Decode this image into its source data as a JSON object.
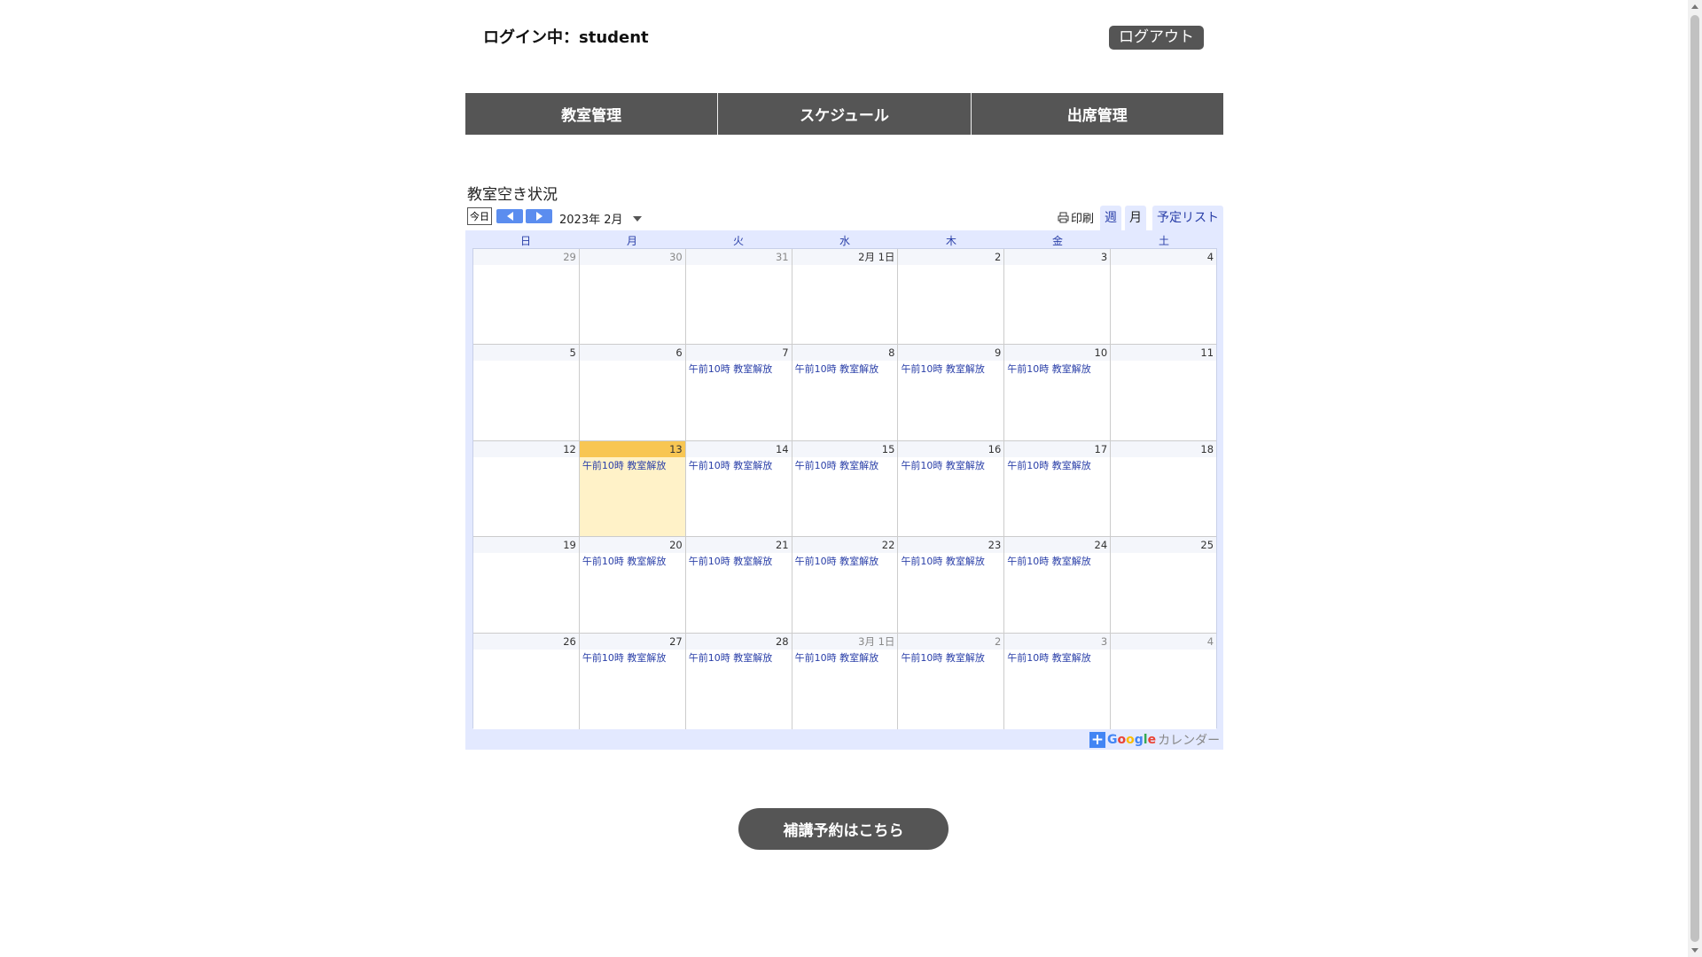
{
  "header": {
    "login_status": "ログイン中：student",
    "logout_label": "ログアウト"
  },
  "nav": {
    "items": [
      "教室管理",
      "スケジュール",
      "出席管理"
    ]
  },
  "calendar": {
    "section_title": "教室空き状況",
    "today_label": "今日",
    "month_label": "2023年 2月",
    "print_label": "印刷",
    "view_tabs": {
      "week": "週",
      "month": "月",
      "list": "予定リスト"
    },
    "weekdays": [
      "日",
      "月",
      "火",
      "水",
      "木",
      "金",
      "土"
    ],
    "brand": {
      "google": "Google",
      "suffix": "カレンダー"
    },
    "weeks": [
      [
        {
          "label": "29",
          "other": true,
          "events": []
        },
        {
          "label": "30",
          "other": true,
          "events": []
        },
        {
          "label": "31",
          "other": true,
          "events": []
        },
        {
          "label": "2月 1日",
          "other": false,
          "events": []
        },
        {
          "label": "2",
          "other": false,
          "events": []
        },
        {
          "label": "3",
          "other": false,
          "events": []
        },
        {
          "label": "4",
          "other": false,
          "events": []
        }
      ],
      [
        {
          "label": "5",
          "other": false,
          "events": []
        },
        {
          "label": "6",
          "other": false,
          "events": []
        },
        {
          "label": "7",
          "other": false,
          "events": [
            "午前10時 教室解放"
          ]
        },
        {
          "label": "8",
          "other": false,
          "events": [
            "午前10時 教室解放"
          ]
        },
        {
          "label": "9",
          "other": false,
          "events": [
            "午前10時 教室解放"
          ]
        },
        {
          "label": "10",
          "other": false,
          "events": [
            "午前10時 教室解放"
          ]
        },
        {
          "label": "11",
          "other": false,
          "events": []
        }
      ],
      [
        {
          "label": "12",
          "other": false,
          "events": []
        },
        {
          "label": "13",
          "other": false,
          "today": true,
          "events": [
            "午前10時 教室解放"
          ]
        },
        {
          "label": "14",
          "other": false,
          "events": [
            "午前10時 教室解放"
          ]
        },
        {
          "label": "15",
          "other": false,
          "events": [
            "午前10時 教室解放"
          ]
        },
        {
          "label": "16",
          "other": false,
          "events": [
            "午前10時 教室解放"
          ]
        },
        {
          "label": "17",
          "other": false,
          "events": [
            "午前10時 教室解放"
          ]
        },
        {
          "label": "18",
          "other": false,
          "events": []
        }
      ],
      [
        {
          "label": "19",
          "other": false,
          "events": []
        },
        {
          "label": "20",
          "other": false,
          "events": [
            "午前10時 教室解放"
          ]
        },
        {
          "label": "21",
          "other": false,
          "events": [
            "午前10時 教室解放"
          ]
        },
        {
          "label": "22",
          "other": false,
          "events": [
            "午前10時 教室解放"
          ]
        },
        {
          "label": "23",
          "other": false,
          "events": [
            "午前10時 教室解放"
          ]
        },
        {
          "label": "24",
          "other": false,
          "events": [
            "午前10時 教室解放"
          ]
        },
        {
          "label": "25",
          "other": false,
          "events": []
        }
      ],
      [
        {
          "label": "26",
          "other": false,
          "events": []
        },
        {
          "label": "27",
          "other": false,
          "events": [
            "午前10時 教室解放"
          ]
        },
        {
          "label": "28",
          "other": false,
          "events": [
            "午前10時 教室解放"
          ]
        },
        {
          "label": "3月 1日",
          "other": true,
          "events": [
            "午前10時 教室解放"
          ]
        },
        {
          "label": "2",
          "other": true,
          "events": [
            "午前10時 教室解放"
          ]
        },
        {
          "label": "3",
          "other": true,
          "events": [
            "午前10時 教室解放"
          ]
        },
        {
          "label": "4",
          "other": true,
          "events": []
        }
      ]
    ]
  },
  "reserve_button_label": "補講予約はこちら"
}
